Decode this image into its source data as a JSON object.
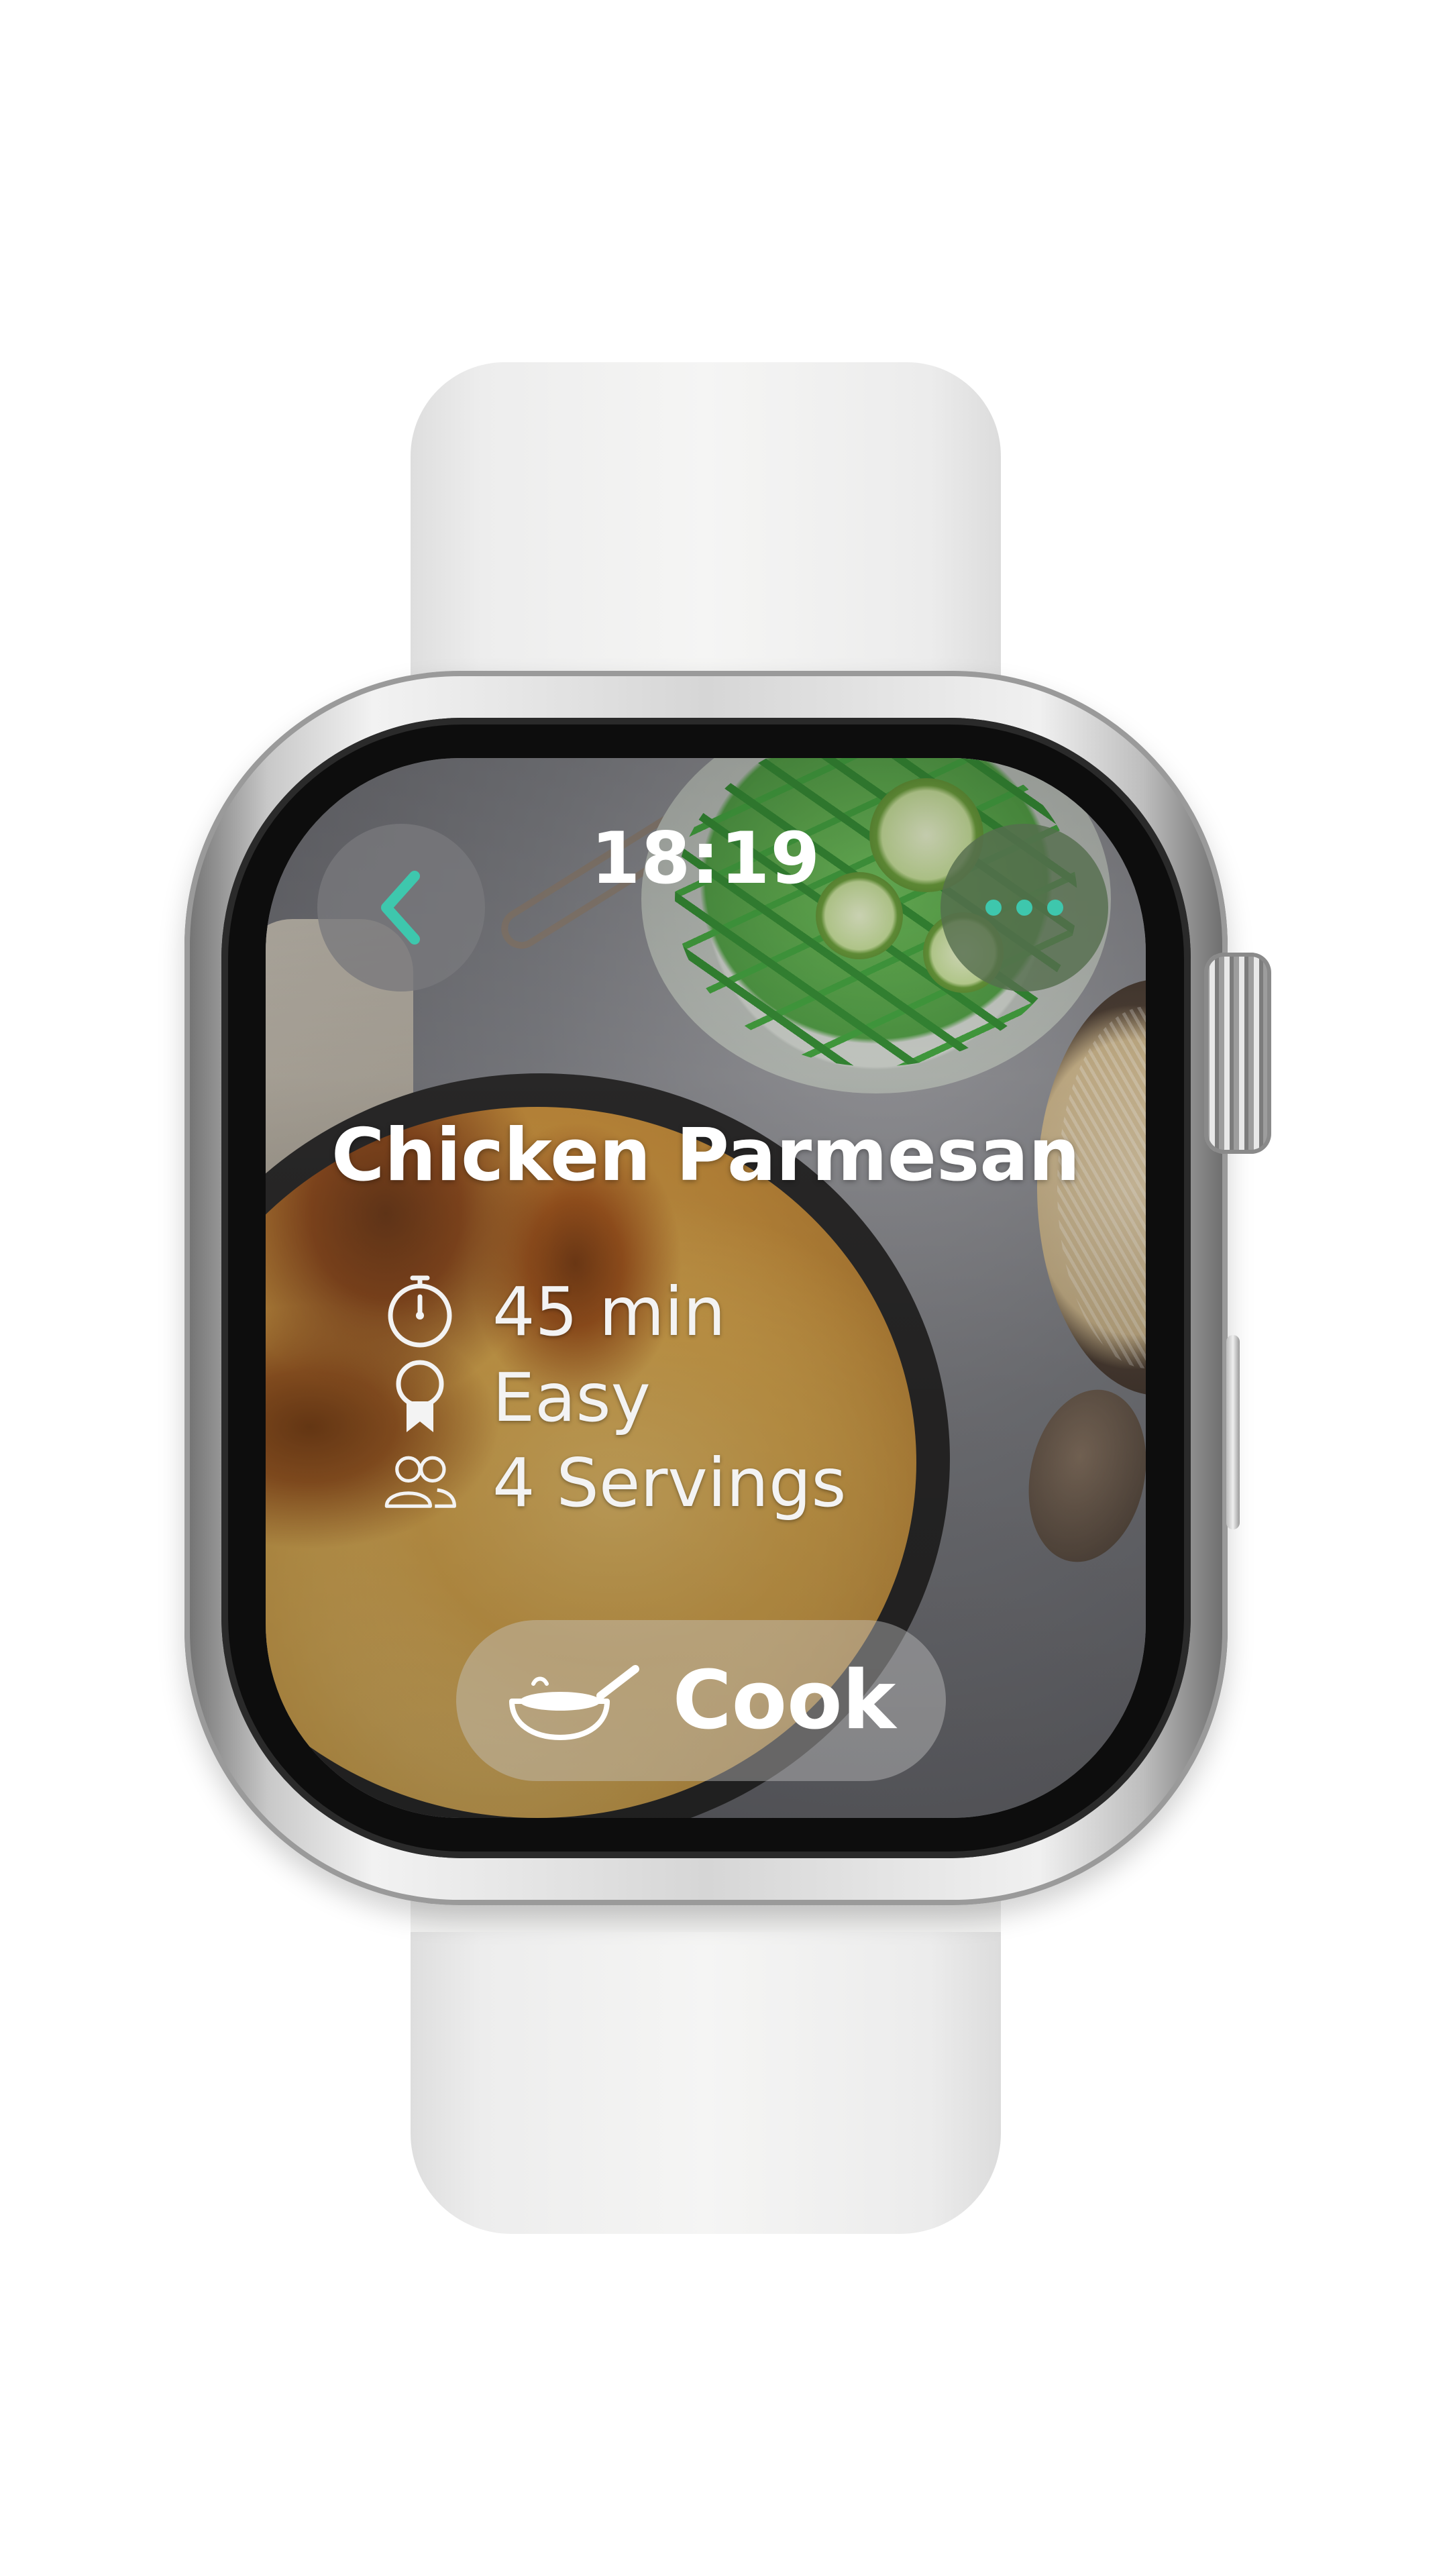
{
  "status": {
    "time": "18:19"
  },
  "nav": {
    "back_icon": "chevron-left-icon",
    "more_icon": "ellipsis-icon",
    "accent_color": "#3ec7ad"
  },
  "recipe": {
    "title": "Chicken Parmesan",
    "duration": "45 min",
    "difficulty": "Easy",
    "servings": "4 Servings",
    "icons": [
      "stopwatch-icon",
      "award-ribbon-icon",
      "people-icon"
    ]
  },
  "actions": {
    "cook_label": "Cook",
    "cook_icon": "pan-icon"
  }
}
